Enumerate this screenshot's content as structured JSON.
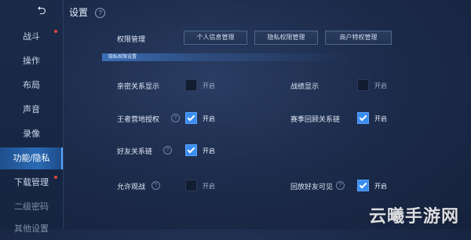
{
  "header": {
    "back_glyph": "⮌",
    "title": "设置",
    "help_glyph": "?"
  },
  "sidebar": {
    "items": [
      {
        "label": "战斗",
        "badge": true
      },
      {
        "label": "操作",
        "badge": false
      },
      {
        "label": "布局",
        "badge": false
      },
      {
        "label": "声音",
        "badge": false
      },
      {
        "label": "录像",
        "badge": false
      },
      {
        "label": "功能/隐私",
        "badge": false,
        "active": true
      },
      {
        "label": "下载管理",
        "badge": true
      },
      {
        "label": "二级密码",
        "badge": false
      },
      {
        "label": "其他设置",
        "badge": false
      }
    ]
  },
  "permissions": {
    "label": "权限管理",
    "tabs": [
      "个人信息管理",
      "隐私权限管理",
      "商户特权管理"
    ]
  },
  "section": {
    "title": "隐私权限设置"
  },
  "options": [
    {
      "label": "亲密关系显示",
      "toggle": "开启",
      "checked": false,
      "help": false
    },
    {
      "label": "战绩显示",
      "toggle": "开启",
      "checked": false,
      "help": false
    },
    {
      "label": "王者营地授权",
      "toggle": "开启",
      "checked": true,
      "help": true
    },
    {
      "label": "赛季回顾关系链",
      "toggle": "开启",
      "checked": true,
      "help": false
    },
    {
      "label": "好友关系链",
      "toggle": "开启",
      "checked": true,
      "help": true
    },
    {
      "label": "允许观战",
      "toggle": "开启",
      "checked": false,
      "help": true
    },
    {
      "label": "回放好友可见",
      "toggle": "开启",
      "checked": true,
      "help": true
    }
  ],
  "watermark": "云曦手游网",
  "colors": {
    "accent": "#3a8df0",
    "badge": "#e0463c",
    "active_nav": "#2b6bb6"
  }
}
